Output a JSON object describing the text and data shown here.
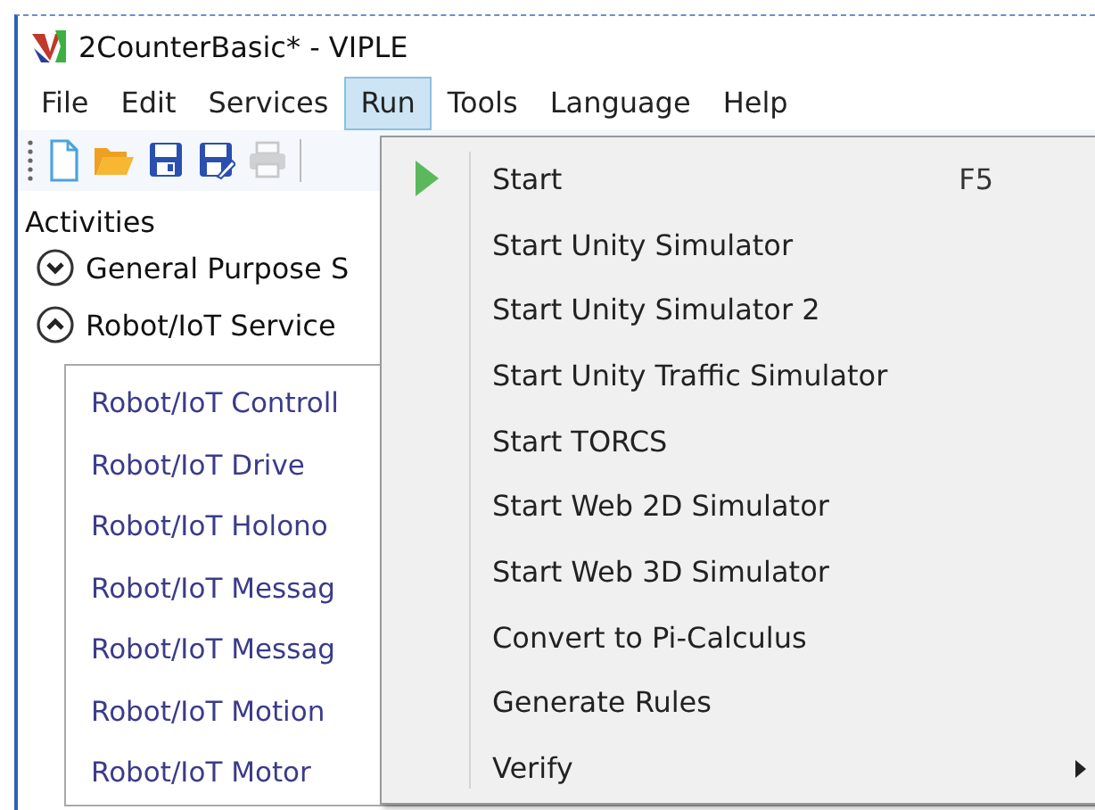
{
  "window": {
    "title": "2CounterBasic* - VIPLE"
  },
  "menu_bar": [
    {
      "label": "File",
      "selected": false
    },
    {
      "label": "Edit",
      "selected": false
    },
    {
      "label": "Services",
      "selected": false
    },
    {
      "label": "Run",
      "selected": true
    },
    {
      "label": "Tools",
      "selected": false
    },
    {
      "label": "Language",
      "selected": false
    },
    {
      "label": "Help",
      "selected": false
    }
  ],
  "toolbar": [
    {
      "kind": "new",
      "disabled": false
    },
    {
      "kind": "open",
      "disabled": false
    },
    {
      "kind": "save",
      "disabled": false
    },
    {
      "kind": "save-as",
      "disabled": false
    },
    {
      "kind": "print",
      "disabled": true
    }
  ],
  "activities": {
    "title": "Activities",
    "groups": [
      {
        "label": "General Purpose S",
        "expanded": false
      },
      {
        "label": "Robot/IoT Service",
        "expanded": true,
        "children": [
          "Robot/IoT Controll",
          "Robot/IoT Drive",
          "Robot/IoT Holono",
          "Robot/IoT Messag",
          "Robot/IoT Messag",
          "Robot/IoT Motion",
          "Robot/IoT Motor"
        ]
      }
    ]
  },
  "run_menu": [
    {
      "kind": "play",
      "label": "Start",
      "shortcut": "F5",
      "submenu": false
    },
    {
      "kind": "plain",
      "label": "Start Unity Simulator",
      "submenu": false
    },
    {
      "kind": "plain",
      "label": "Start Unity Simulator 2",
      "submenu": false
    },
    {
      "kind": "plain",
      "label": "Start Unity Traffic Simulator",
      "submenu": false
    },
    {
      "kind": "plain",
      "label": "Start TORCS",
      "submenu": false
    },
    {
      "kind": "plain",
      "label": "Start Web 2D Simulator",
      "submenu": false
    },
    {
      "kind": "plain",
      "label": "Start Web 3D Simulator",
      "submenu": false
    },
    {
      "kind": "plain",
      "label": "Convert to Pi-Calculus",
      "submenu": false
    },
    {
      "kind": "plain",
      "label": "Generate Rules",
      "submenu": false
    },
    {
      "kind": "plain",
      "label": "Verify",
      "submenu": true
    }
  ]
}
